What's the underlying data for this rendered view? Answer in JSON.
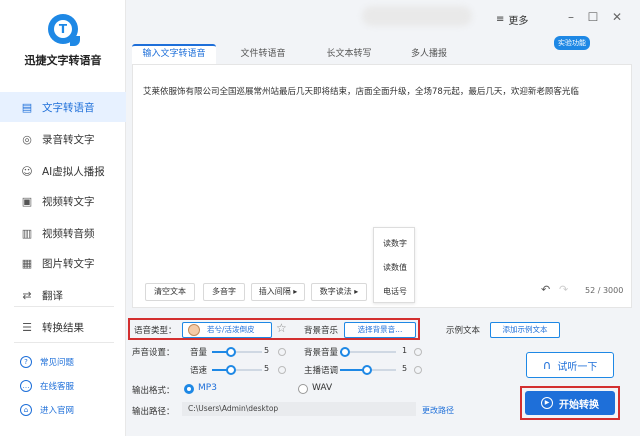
{
  "app": {
    "name": "迅捷文字转语音",
    "logo_letter": "T"
  },
  "sidebar": {
    "items": [
      {
        "label": "文字转语音",
        "icon": "text-voice-icon",
        "active": true
      },
      {
        "label": "录音转文字",
        "icon": "microphone-icon"
      },
      {
        "label": "AI虚拟人播报",
        "icon": "ai-icon"
      },
      {
        "label": "视频转文字",
        "icon": "video-icon"
      },
      {
        "label": "视频转音频",
        "icon": "video-audio-icon"
      },
      {
        "label": "图片转文字",
        "icon": "image-icon"
      },
      {
        "label": "翻译",
        "icon": "translate-icon"
      },
      {
        "label": "转换结果",
        "icon": "result-icon"
      }
    ],
    "footer": [
      {
        "label": "常见问题",
        "icon": "question-icon"
      },
      {
        "label": "在线客服",
        "icon": "chat-icon"
      },
      {
        "label": "进入官网",
        "icon": "home-icon"
      }
    ]
  },
  "header": {
    "more_label": "更多"
  },
  "tabs": [
    {
      "label": "输入文字转语音"
    },
    {
      "label": "文件转语音"
    },
    {
      "label": "长文本转写"
    },
    {
      "label": "多人播报"
    }
  ],
  "tab_badge": "实验功能",
  "editor": {
    "text": "艾莱依服饰有限公司全国巡展常州站最后几天即将结束，店面全面升级，全场78元起，最后几天，欢迎新老顾客光临",
    "popup_items": [
      "读数字",
      "读数值",
      "电话号"
    ],
    "buttons": {
      "clear": "清空文本",
      "polyphone": "多音字",
      "insert_pause": "插入间隔",
      "number_reading": "数字读法"
    },
    "char_count": "52 / 3000"
  },
  "settings": {
    "voice_type_label": "语音类型：",
    "voice_name": "若兮/活泼倒皮",
    "bg_music_label": "背景音乐",
    "bg_music_button": "选择背景音...",
    "example_text_label": "示例文本",
    "add_example_button": "添加示例文本",
    "sound_settings_label": "声音设置：",
    "volume_label": "音量",
    "volume_value": "5",
    "bg_volume_label": "背景音量",
    "bg_volume_value": "1",
    "speed_label": "语速",
    "speed_value": "5",
    "pitch_label": "主播语调",
    "pitch_value": "5",
    "format_label": "输出格式：",
    "format_mp3": "MP3",
    "format_wav": "WAV",
    "path_label": "输出路径：",
    "path_value": "C:\\Users\\Admin\\desktop",
    "change_path": "更改路径",
    "try_button": "试听一下",
    "start_button": "开始转换"
  },
  "colors": {
    "accent": "#1e6fd9",
    "highlight": "#d32f2f"
  }
}
